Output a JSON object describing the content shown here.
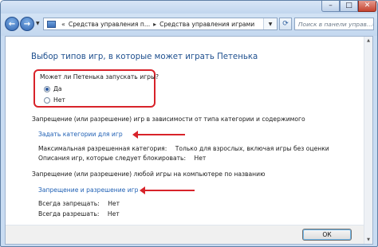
{
  "window": {
    "minimize_icon": "minimize-icon",
    "maximize_icon": "maximize-icon",
    "close_icon": "close-icon"
  },
  "navigation": {
    "back_icon": "back-arrow-icon",
    "forward_icon": "forward-arrow-icon",
    "breadcrumb": [
      "Средства управления п...",
      "Средства управления играми"
    ],
    "search_placeholder": "Поиск в панели управ...",
    "refresh_icon": "refresh-icon",
    "search_icon": "search-icon"
  },
  "main": {
    "heading": "Выбор типов игр, в которые может играть Петенька",
    "question": "Может ли Петенька запускать игры?",
    "options": [
      {
        "label": "Да",
        "selected": true
      },
      {
        "label": "Нет",
        "selected": false
      }
    ],
    "section1": {
      "text": "Запрещение (или разрешение) игр в зависимости от типа категории и содержимого",
      "link": "Задать категории для игр",
      "max_rating_label": "Максимальная разрешенная категория:",
      "max_rating_value": "Только для взрослых, включая игры без оценки",
      "blocked_label": "Описания игр, которые следует блокировать:",
      "blocked_value": "Нет"
    },
    "section2": {
      "text": "Запрещение (или разрешение) любой игры на компьютере по названию",
      "link": "Запрещение и разрешение игр",
      "always_block_label": "Всегда запрещать:",
      "always_block_value": "Нет",
      "always_allow_label": "Всегда разрешать:",
      "always_allow_value": "Нет"
    }
  },
  "footer": {
    "ok_label": "ОК"
  },
  "colors": {
    "annotation": "#d8232a",
    "link": "#1e5fb4",
    "heading": "#1e4f8e"
  }
}
